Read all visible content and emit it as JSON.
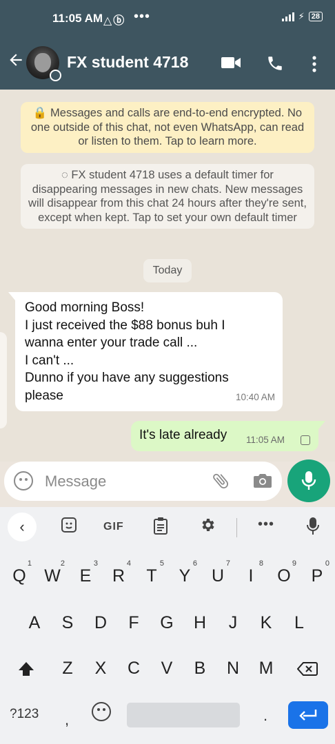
{
  "status_bar": {
    "time": "11:05 AM",
    "icons": "△ⓑ",
    "dots": "•••",
    "battery": "28"
  },
  "header": {
    "back_icon": "arrow-left-icon",
    "contact_name": "FX student 4718",
    "icons": [
      "video-call-icon",
      "phone-icon",
      "more-vert-icon"
    ]
  },
  "chat": {
    "encryption_notice": "🔒 Messages and calls are end-to-end encrypted. No one outside of this chat, not even WhatsApp, can read or listen to them. Tap to learn more.",
    "timer_notice": "◌ FX student 4718 uses a default timer for disappearing messages in new chats. New messages will disappear from this chat 24 hours after they're sent, except when kept. Tap to set your own default timer",
    "day_label": "Today",
    "incoming": {
      "lines": [
        "Good morning Boss!",
        "I just received the $88 bonus buh I",
        "wanna enter your trade call ...",
        "I can't ...",
        "Dunno if you have any suggestions",
        "please"
      ],
      "time": "10:40 AM"
    },
    "outgoing": {
      "text": "It's late already",
      "time": "11:05 AM"
    }
  },
  "composer": {
    "placeholder": "Message"
  },
  "keyboard": {
    "toolbar": {
      "gif": "GIF",
      "back": "‹",
      "more": "•••"
    },
    "row1": [
      {
        "k": "Q",
        "n": "1"
      },
      {
        "k": "W",
        "n": "2"
      },
      {
        "k": "E",
        "n": "3"
      },
      {
        "k": "R",
        "n": "4"
      },
      {
        "k": "T",
        "n": "5"
      },
      {
        "k": "Y",
        "n": "6"
      },
      {
        "k": "U",
        "n": "7"
      },
      {
        "k": "I",
        "n": "8"
      },
      {
        "k": "O",
        "n": "9"
      },
      {
        "k": "P",
        "n": "0"
      }
    ],
    "row2": [
      "A",
      "S",
      "D",
      "F",
      "G",
      "H",
      "J",
      "K",
      "L"
    ],
    "row3": [
      "Z",
      "X",
      "C",
      "V",
      "B",
      "N",
      "M"
    ],
    "sym": "?123",
    "comma": ",",
    "period": "."
  },
  "colors": {
    "header": "#3e5560",
    "accent": "#18a47a",
    "outgoing_bubble": "#dcf8c6",
    "notice_yellow": "#fdf0c4"
  }
}
